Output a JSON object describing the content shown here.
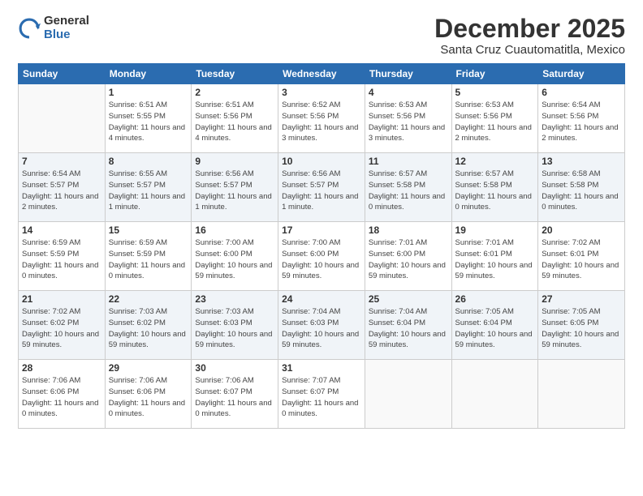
{
  "logo": {
    "general": "General",
    "blue": "Blue"
  },
  "title": "December 2025",
  "location": "Santa Cruz Cuautomatitla, Mexico",
  "days_of_week": [
    "Sunday",
    "Monday",
    "Tuesday",
    "Wednesday",
    "Thursday",
    "Friday",
    "Saturday"
  ],
  "weeks": [
    [
      {
        "day": "",
        "sunrise": "",
        "sunset": "",
        "daylight": ""
      },
      {
        "day": "1",
        "sunrise": "Sunrise: 6:51 AM",
        "sunset": "Sunset: 5:55 PM",
        "daylight": "Daylight: 11 hours and 4 minutes."
      },
      {
        "day": "2",
        "sunrise": "Sunrise: 6:51 AM",
        "sunset": "Sunset: 5:56 PM",
        "daylight": "Daylight: 11 hours and 4 minutes."
      },
      {
        "day": "3",
        "sunrise": "Sunrise: 6:52 AM",
        "sunset": "Sunset: 5:56 PM",
        "daylight": "Daylight: 11 hours and 3 minutes."
      },
      {
        "day": "4",
        "sunrise": "Sunrise: 6:53 AM",
        "sunset": "Sunset: 5:56 PM",
        "daylight": "Daylight: 11 hours and 3 minutes."
      },
      {
        "day": "5",
        "sunrise": "Sunrise: 6:53 AM",
        "sunset": "Sunset: 5:56 PM",
        "daylight": "Daylight: 11 hours and 2 minutes."
      },
      {
        "day": "6",
        "sunrise": "Sunrise: 6:54 AM",
        "sunset": "Sunset: 5:56 PM",
        "daylight": "Daylight: 11 hours and 2 minutes."
      }
    ],
    [
      {
        "day": "7",
        "sunrise": "Sunrise: 6:54 AM",
        "sunset": "Sunset: 5:57 PM",
        "daylight": "Daylight: 11 hours and 2 minutes."
      },
      {
        "day": "8",
        "sunrise": "Sunrise: 6:55 AM",
        "sunset": "Sunset: 5:57 PM",
        "daylight": "Daylight: 11 hours and 1 minute."
      },
      {
        "day": "9",
        "sunrise": "Sunrise: 6:56 AM",
        "sunset": "Sunset: 5:57 PM",
        "daylight": "Daylight: 11 hours and 1 minute."
      },
      {
        "day": "10",
        "sunrise": "Sunrise: 6:56 AM",
        "sunset": "Sunset: 5:57 PM",
        "daylight": "Daylight: 11 hours and 1 minute."
      },
      {
        "day": "11",
        "sunrise": "Sunrise: 6:57 AM",
        "sunset": "Sunset: 5:58 PM",
        "daylight": "Daylight: 11 hours and 0 minutes."
      },
      {
        "day": "12",
        "sunrise": "Sunrise: 6:57 AM",
        "sunset": "Sunset: 5:58 PM",
        "daylight": "Daylight: 11 hours and 0 minutes."
      },
      {
        "day": "13",
        "sunrise": "Sunrise: 6:58 AM",
        "sunset": "Sunset: 5:58 PM",
        "daylight": "Daylight: 11 hours and 0 minutes."
      }
    ],
    [
      {
        "day": "14",
        "sunrise": "Sunrise: 6:59 AM",
        "sunset": "Sunset: 5:59 PM",
        "daylight": "Daylight: 11 hours and 0 minutes."
      },
      {
        "day": "15",
        "sunrise": "Sunrise: 6:59 AM",
        "sunset": "Sunset: 5:59 PM",
        "daylight": "Daylight: 11 hours and 0 minutes."
      },
      {
        "day": "16",
        "sunrise": "Sunrise: 7:00 AM",
        "sunset": "Sunset: 6:00 PM",
        "daylight": "Daylight: 10 hours and 59 minutes."
      },
      {
        "day": "17",
        "sunrise": "Sunrise: 7:00 AM",
        "sunset": "Sunset: 6:00 PM",
        "daylight": "Daylight: 10 hours and 59 minutes."
      },
      {
        "day": "18",
        "sunrise": "Sunrise: 7:01 AM",
        "sunset": "Sunset: 6:00 PM",
        "daylight": "Daylight: 10 hours and 59 minutes."
      },
      {
        "day": "19",
        "sunrise": "Sunrise: 7:01 AM",
        "sunset": "Sunset: 6:01 PM",
        "daylight": "Daylight: 10 hours and 59 minutes."
      },
      {
        "day": "20",
        "sunrise": "Sunrise: 7:02 AM",
        "sunset": "Sunset: 6:01 PM",
        "daylight": "Daylight: 10 hours and 59 minutes."
      }
    ],
    [
      {
        "day": "21",
        "sunrise": "Sunrise: 7:02 AM",
        "sunset": "Sunset: 6:02 PM",
        "daylight": "Daylight: 10 hours and 59 minutes."
      },
      {
        "day": "22",
        "sunrise": "Sunrise: 7:03 AM",
        "sunset": "Sunset: 6:02 PM",
        "daylight": "Daylight: 10 hours and 59 minutes."
      },
      {
        "day": "23",
        "sunrise": "Sunrise: 7:03 AM",
        "sunset": "Sunset: 6:03 PM",
        "daylight": "Daylight: 10 hours and 59 minutes."
      },
      {
        "day": "24",
        "sunrise": "Sunrise: 7:04 AM",
        "sunset": "Sunset: 6:03 PM",
        "daylight": "Daylight: 10 hours and 59 minutes."
      },
      {
        "day": "25",
        "sunrise": "Sunrise: 7:04 AM",
        "sunset": "Sunset: 6:04 PM",
        "daylight": "Daylight: 10 hours and 59 minutes."
      },
      {
        "day": "26",
        "sunrise": "Sunrise: 7:05 AM",
        "sunset": "Sunset: 6:04 PM",
        "daylight": "Daylight: 10 hours and 59 minutes."
      },
      {
        "day": "27",
        "sunrise": "Sunrise: 7:05 AM",
        "sunset": "Sunset: 6:05 PM",
        "daylight": "Daylight: 10 hours and 59 minutes."
      }
    ],
    [
      {
        "day": "28",
        "sunrise": "Sunrise: 7:06 AM",
        "sunset": "Sunset: 6:06 PM",
        "daylight": "Daylight: 11 hours and 0 minutes."
      },
      {
        "day": "29",
        "sunrise": "Sunrise: 7:06 AM",
        "sunset": "Sunset: 6:06 PM",
        "daylight": "Daylight: 11 hours and 0 minutes."
      },
      {
        "day": "30",
        "sunrise": "Sunrise: 7:06 AM",
        "sunset": "Sunset: 6:07 PM",
        "daylight": "Daylight: 11 hours and 0 minutes."
      },
      {
        "day": "31",
        "sunrise": "Sunrise: 7:07 AM",
        "sunset": "Sunset: 6:07 PM",
        "daylight": "Daylight: 11 hours and 0 minutes."
      },
      {
        "day": "",
        "sunrise": "",
        "sunset": "",
        "daylight": ""
      },
      {
        "day": "",
        "sunrise": "",
        "sunset": "",
        "daylight": ""
      },
      {
        "day": "",
        "sunrise": "",
        "sunset": "",
        "daylight": ""
      }
    ]
  ]
}
